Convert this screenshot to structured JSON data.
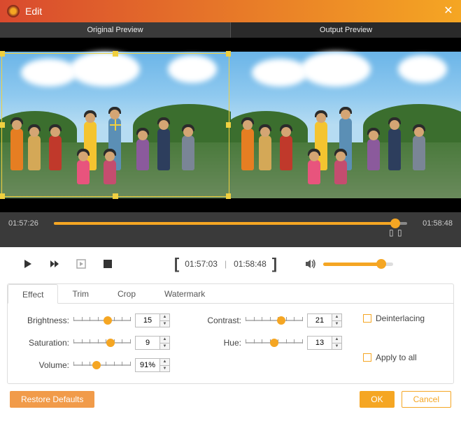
{
  "titlebar": {
    "title": "Edit"
  },
  "preview": {
    "left_label": "Original Preview",
    "right_label": "Output Preview"
  },
  "timeline": {
    "start": "01:57:26",
    "end": "01:58:48"
  },
  "controls": {
    "trim_start": "01:57:03",
    "trim_end": "01:58:48"
  },
  "tabs": {
    "t1": "Effect",
    "t2": "Trim",
    "t3": "Crop",
    "t4": "Watermark"
  },
  "effect": {
    "brightness": {
      "label": "Brightness:",
      "value": "15",
      "pos": 60
    },
    "saturation": {
      "label": "Saturation:",
      "value": "9",
      "pos": 65
    },
    "volume": {
      "label": "Volume:",
      "value": "91%",
      "pos": 40
    },
    "contrast": {
      "label": "Contrast:",
      "value": "21",
      "pos": 62
    },
    "hue": {
      "label": "Hue:",
      "value": "13",
      "pos": 50
    }
  },
  "checks": {
    "deinterlacing": "Deinterlacing",
    "apply_all": "Apply to all"
  },
  "footer": {
    "restore": "Restore Defaults",
    "ok": "OK",
    "cancel": "Cancel"
  },
  "colors": {
    "accent": "#f5a623"
  }
}
